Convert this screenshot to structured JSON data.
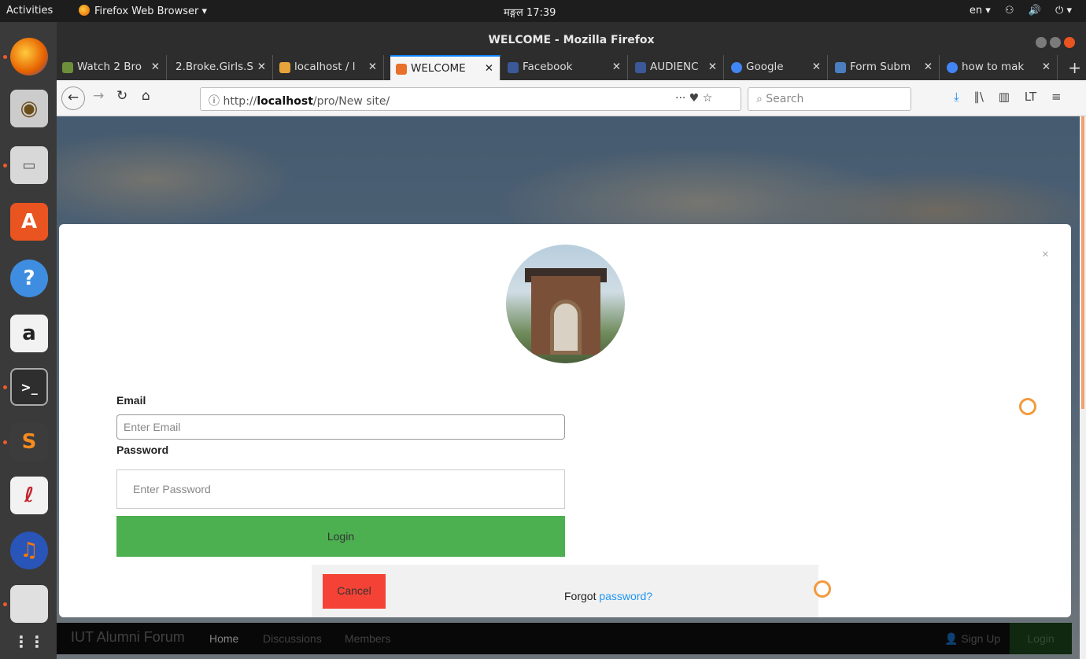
{
  "topbar": {
    "activities": "Activities",
    "app_menu": "Firefox Web Browser ▾",
    "clock": "मङ्गल 17:39",
    "lang": "en ▾",
    "tray_icons": [
      "accessibility-icon",
      "volume-icon",
      "power-icon"
    ]
  },
  "window": {
    "title": "WELCOME - Mozilla Firefox"
  },
  "tabs": [
    {
      "label": "Watch 2 Bro",
      "fav": "#6c8f3a"
    },
    {
      "label": "2.Broke.Girls.S",
      "fav": ""
    },
    {
      "label": "localhost / l",
      "fav": "#e7a43a"
    },
    {
      "label": "WELCOME",
      "fav": "#e8702a",
      "active": true
    },
    {
      "label": "Facebook",
      "fav": "#3b5998"
    },
    {
      "label": "AUDIENC",
      "fav": "#3b5998"
    },
    {
      "label": "Google",
      "fav": "#4285f4"
    },
    {
      "label": "Form Subm",
      "fav": "#4a7ebf"
    },
    {
      "label": "how to mak",
      "fav": "#4285f4"
    }
  ],
  "nav": {
    "url_prefix": "http://",
    "url_host": "localhost",
    "url_path": "/pro/New site/",
    "url_actions": "··· ♥ ☆",
    "search_placeholder": "Search"
  },
  "site_nav": {
    "brand": "IUT Alumni Forum",
    "links": [
      "Home",
      "Discussions",
      "Members"
    ],
    "signup": "Sign Up",
    "login": "Login"
  },
  "modal": {
    "close": "×",
    "email_label": "Email",
    "email_placeholder": "Enter Email",
    "password_label": "Password",
    "password_placeholder": "Enter Password",
    "login_button": "Login",
    "cancel_button": "Cancel",
    "forgot_text": "Forgot ",
    "forgot_link": "password?"
  },
  "colors": {
    "login_green": "#4caf50",
    "cancel_red": "#f44336",
    "link_blue": "#2196f3",
    "spinner_orange": "#f39a3c"
  }
}
